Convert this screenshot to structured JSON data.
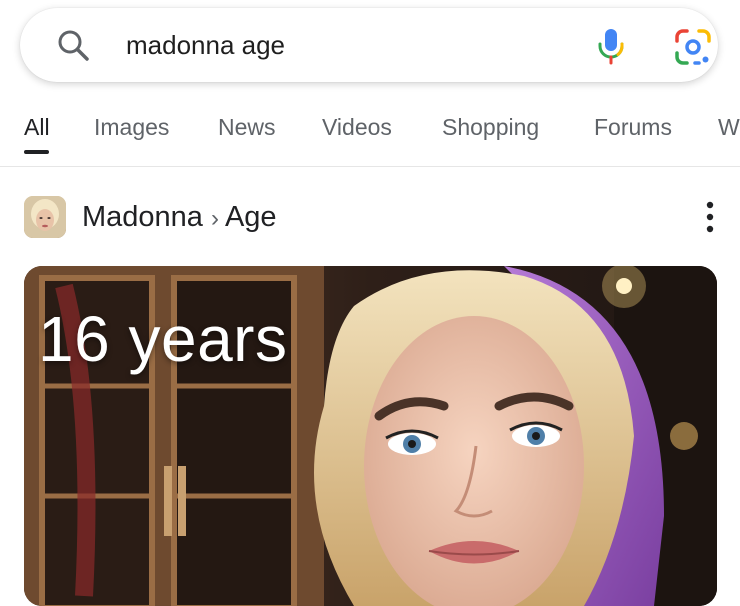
{
  "search": {
    "query": "madonna age",
    "icons": {
      "search": "search-icon",
      "voice": "mic-icon",
      "lens": "google-lens-icon"
    }
  },
  "tabs": [
    {
      "label": "All",
      "active": true
    },
    {
      "label": "Images"
    },
    {
      "label": "News"
    },
    {
      "label": "Videos"
    },
    {
      "label": "Shopping"
    },
    {
      "label": "Forums"
    },
    {
      "label": "W"
    }
  ],
  "result": {
    "entity": "Madonna",
    "separator": "›",
    "attribute": "Age",
    "age_overlay": "16 years"
  },
  "colors": {
    "google_blue": "#4285F4",
    "google_red": "#EA4335",
    "google_yellow": "#FBBC05",
    "google_green": "#34A853"
  }
}
